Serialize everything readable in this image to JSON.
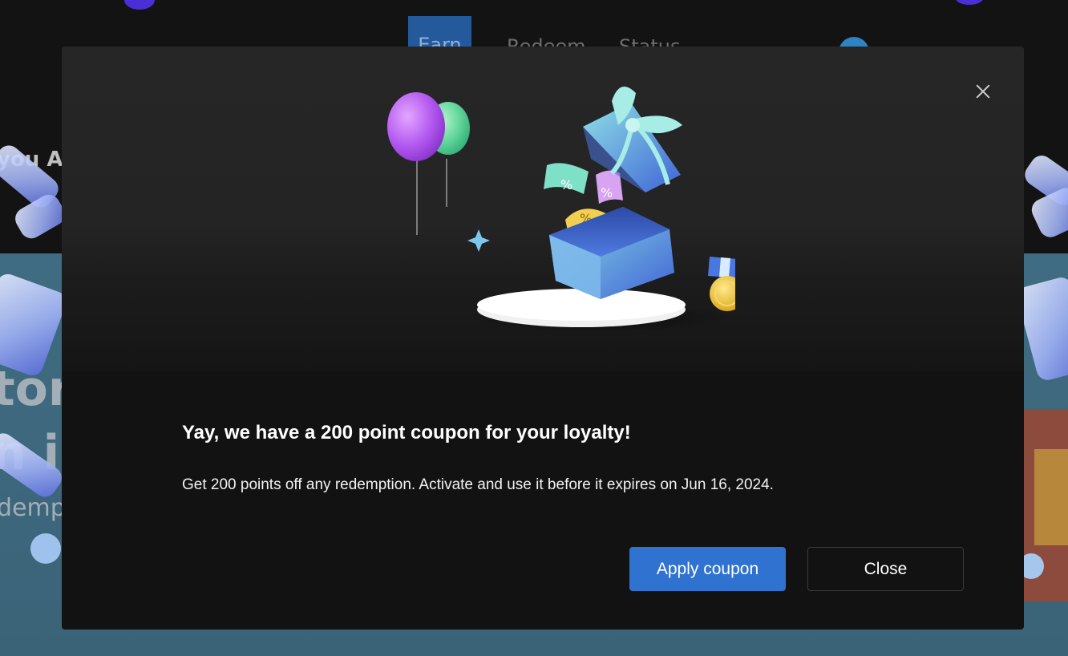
{
  "background": {
    "tabs": [
      {
        "label": "Earn",
        "active": true
      },
      {
        "label": "Redeem",
        "active": false
      },
      {
        "label": "Status",
        "active": false
      }
    ],
    "fragments": [
      "you A",
      "tor",
      "n i",
      "demp"
    ]
  },
  "dialog": {
    "title": "Yay, we have a 200 point coupon for your loyalty!",
    "description": "Get 200 points off any redemption. Activate and use it before it expires on Jun 16, 2024.",
    "apply_label": "Apply coupon",
    "close_label": "Close",
    "accent_color": "#2f72d0",
    "coupon_glyph": "%"
  }
}
